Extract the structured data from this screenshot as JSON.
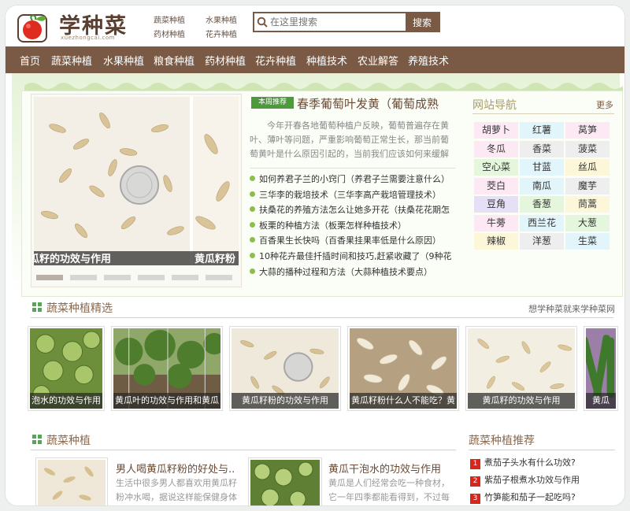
{
  "header": {
    "logo_text": "学种菜",
    "logo_url": "xuezhongcai.com",
    "top_links": [
      "蔬菜种植",
      "水果种植",
      "药材种植",
      "花卉种植"
    ],
    "search_placeholder": "在这里搜索",
    "search_button": "搜索"
  },
  "nav": [
    "首页",
    "蔬菜种植",
    "水果种植",
    "粮食种植",
    "药材种植",
    "花卉种植",
    "种植技术",
    "农业解答",
    "养殖技术"
  ],
  "slider": {
    "captions": [
      "瓜籽的功效与作用",
      "黄瓜籽粉"
    ],
    "dot_count": 6
  },
  "recommend": {
    "badge": "本周推荐",
    "title": "春季葡萄叶发黄（葡萄成熟",
    "desc": "今年开春各地葡萄种植户反映，葡萄普遍存在黄叶、薄叶等问题，严重影响葡萄正常生长，那当前葡萄黄叶是什么原因引起的，当前我们应该如何来缓解",
    "list": [
      "如何养君子兰的小窍门（养君子兰需要注意什么）",
      "三华李的栽培技术（三华李高产栽培管理技术）",
      "扶桑花的养殖方法怎么让她多开花（扶桑花花期怎",
      "板栗的种植方法（板栗怎样种植技术）",
      "百香果生长快吗（百香果挂果率低是什么原因）",
      "10种花卉最佳扦插时间和技巧,赶紧收藏了（9种花",
      "大蒜的播种过程和方法（大蒜种植技术要点）"
    ]
  },
  "site_nav": {
    "title": "网站导航",
    "more": "更多",
    "tags": [
      {
        "label": "胡萝卜",
        "color": "#fde9f4"
      },
      {
        "label": "红薯",
        "color": "#e2f5fb"
      },
      {
        "label": "莴笋",
        "color": "#fde9f4"
      },
      {
        "label": "冬瓜",
        "color": "#fde9f4"
      },
      {
        "label": "香菜",
        "color": "#eeeeee"
      },
      {
        "label": "菠菜",
        "color": "#eeeeee"
      },
      {
        "label": "空心菜",
        "color": "#e4f7dc"
      },
      {
        "label": "甘蓝",
        "color": "#e2f5fb"
      },
      {
        "label": "丝瓜",
        "color": "#fbf7d8"
      },
      {
        "label": "茭白",
        "color": "#fde9f4"
      },
      {
        "label": "南瓜",
        "color": "#e2f5fb"
      },
      {
        "label": "魔芋",
        "color": "#eeeeee"
      },
      {
        "label": "豆角",
        "color": "#e6e0f6"
      },
      {
        "label": "香葱",
        "color": "#e4f7dc"
      },
      {
        "label": "茼蒿",
        "color": "#fbf7d8"
      },
      {
        "label": "牛蒡",
        "color": "#fde9f4"
      },
      {
        "label": "西兰花",
        "color": "#e2f5fb"
      },
      {
        "label": "大葱",
        "color": "#e4f7dc"
      },
      {
        "label": "辣椒",
        "color": "#fbf7d8"
      },
      {
        "label": "洋葱",
        "color": "#eeeeee"
      },
      {
        "label": "生菜",
        "color": "#e2f5fb"
      }
    ]
  },
  "featured": {
    "title": "蔬菜种植精选",
    "slogan": "想学种菜就来学种菜网",
    "items": [
      "泡水的功效与作用",
      "黄瓜叶的功效与作用和黄瓜",
      "黄瓜籽粉的功效与作用",
      "黄瓜籽粉什么人不能吃？黄",
      "黄瓜籽的功效与作用",
      "黄瓜"
    ]
  },
  "veg": {
    "title": "蔬菜种植",
    "articles": [
      {
        "title": "男人喝黄瓜籽粉的好处与...",
        "desc": "生活中很多男人都喜欢用黄瓜籽粉冲水喝，据说这样能保健身体"
      },
      {
        "title": "黄瓜干泡水的功效与作用",
        "desc": "黄瓜是人们经常会吃一种食材，它一年四季都能看得到，不过每"
      }
    ]
  },
  "side_rec": {
    "title": "蔬菜种植推荐",
    "items": [
      "煮茄子头水有什么功效?",
      "紫茄子根煮水功效与作用",
      "竹笋能和茄子一起吃吗?"
    ]
  }
}
